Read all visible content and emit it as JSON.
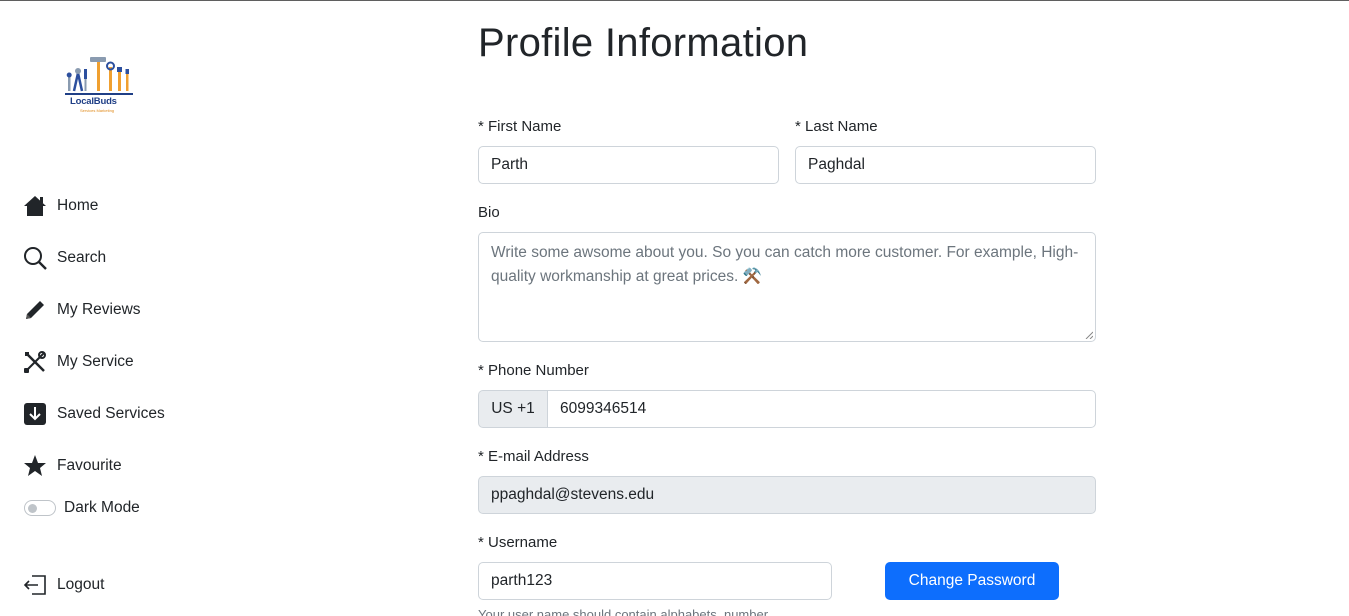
{
  "brand": {
    "name": "LocalBuds",
    "tagline": "Services Marketing"
  },
  "sidebar": {
    "items": [
      {
        "label": "Home",
        "icon": "home-icon"
      },
      {
        "label": "Search",
        "icon": "search-icon"
      },
      {
        "label": "My Reviews",
        "icon": "pencil-icon"
      },
      {
        "label": "My Service",
        "icon": "tools-icon"
      },
      {
        "label": "Saved Services",
        "icon": "download-box-icon"
      },
      {
        "label": "Favourite",
        "icon": "star-icon"
      }
    ],
    "dark_mode_label": "Dark Mode",
    "dark_mode_on": false,
    "logout_label": "Logout"
  },
  "main": {
    "title": "Profile Information",
    "first_name": {
      "label": "* First Name",
      "value": "Parth"
    },
    "last_name": {
      "label": "* Last Name",
      "value": "Paghdal"
    },
    "bio": {
      "label": "Bio",
      "placeholder": "Write some awsome about you. So you can catch more customer. For example, High-quality workmanship at great prices. ⚒️"
    },
    "phone": {
      "label": "* Phone Number",
      "prefix": "US +1",
      "value": "6099346514"
    },
    "email": {
      "label": "* E-mail Address",
      "value": "ppaghdal@stevens.edu"
    },
    "username": {
      "label": "* Username",
      "value": "parth123",
      "help": "Your user name should contain alphabets, number"
    },
    "change_password_label": "Change Password"
  },
  "colors": {
    "primary": "#0d6efd",
    "brand_navy": "#1f3f86",
    "brand_orange": "#e08a1a"
  }
}
